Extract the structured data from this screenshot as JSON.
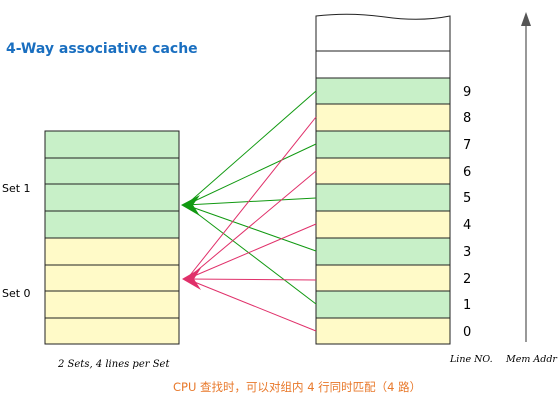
{
  "title": "4-Way associative cache",
  "cache": {
    "set_labels": [
      "Set 1",
      "Set 0"
    ],
    "caption": "2 Sets, 4 lines per Set",
    "set_colors": {
      "set1": "#c8f0c8",
      "set0": "#fffac8"
    }
  },
  "memory": {
    "line_numbers": [
      "9",
      "8",
      "7",
      "6",
      "5",
      "4",
      "3",
      "2",
      "1",
      "0"
    ],
    "axis_label_line": "Line NO.",
    "axis_label_addr": "Mem Addr"
  },
  "mapping": {
    "set1_color": "#119911",
    "set0_color": "#e0306a"
  },
  "footer": "CPU 查找时，可以对组内 4 行同时匹配（4 路）"
}
